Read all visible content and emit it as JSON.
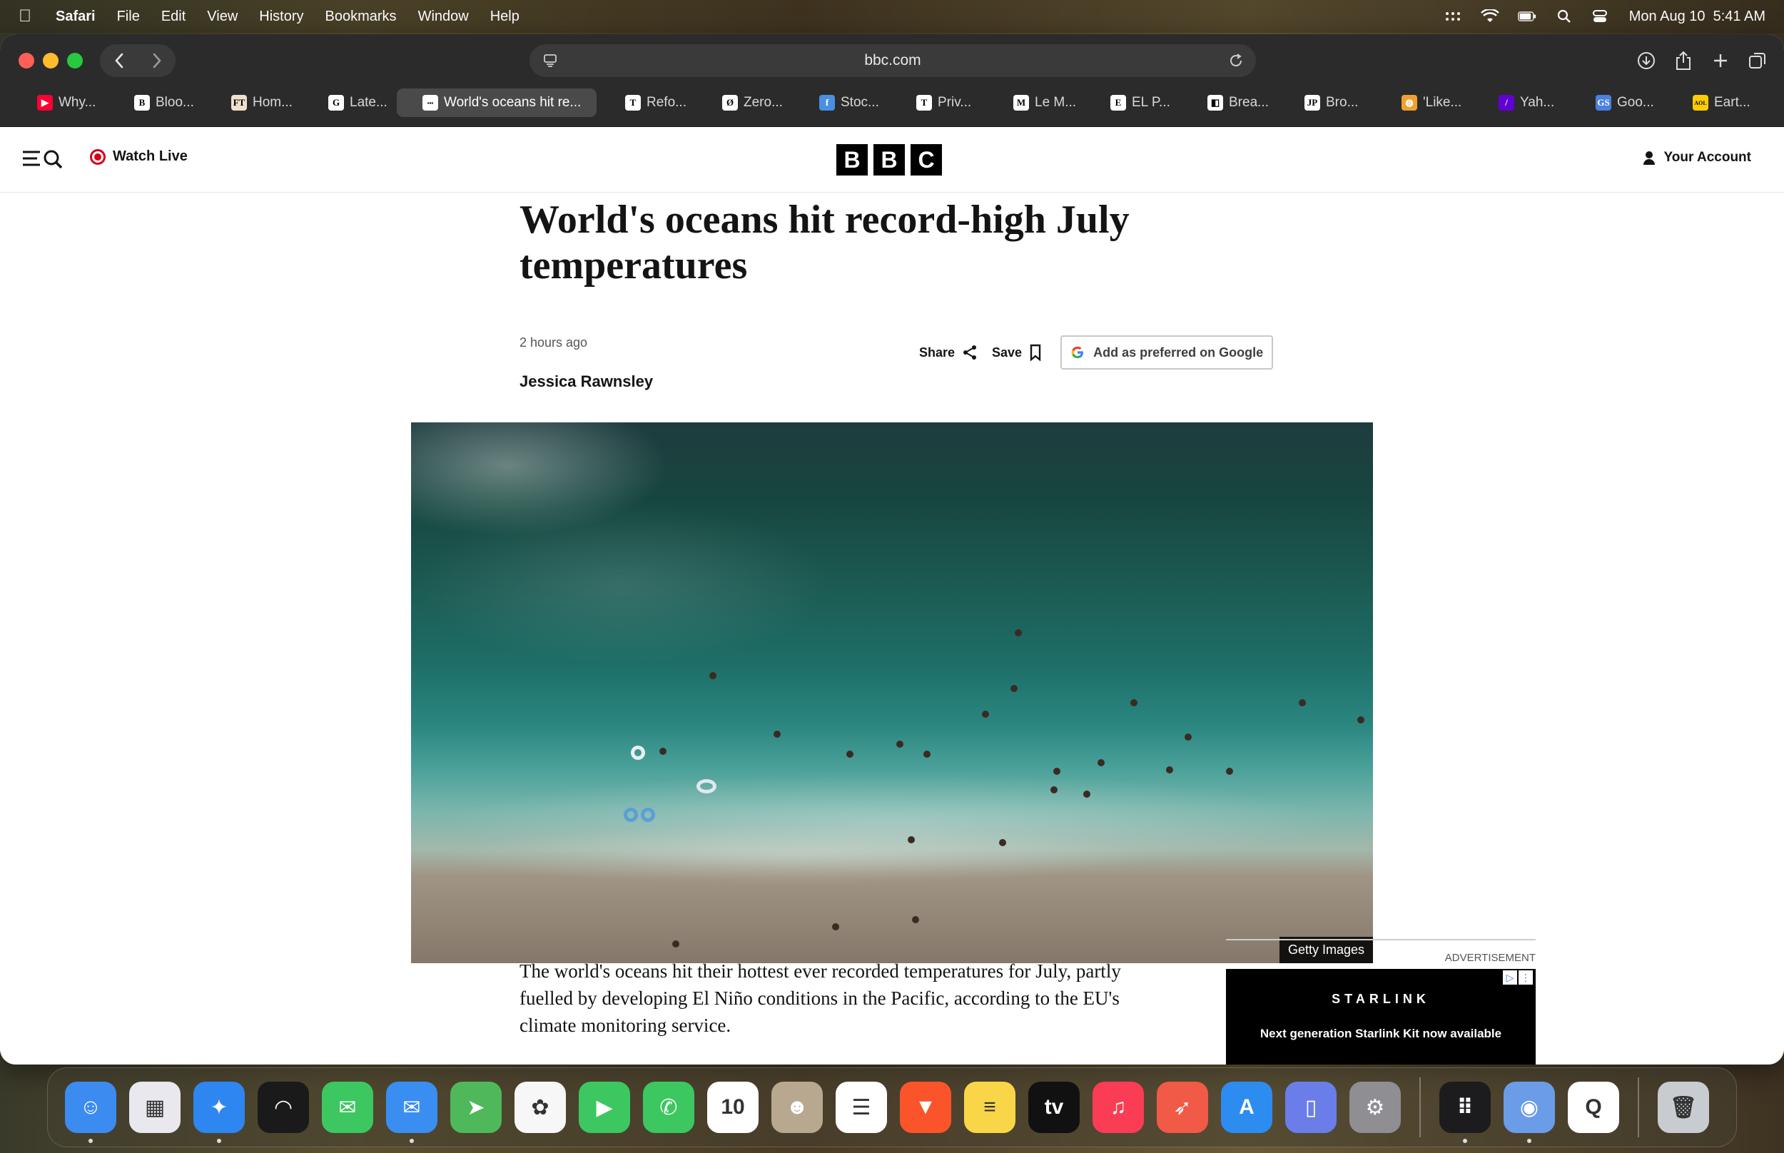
{
  "menubar": {
    "app_name": "Safari",
    "items": [
      "File",
      "Edit",
      "View",
      "History",
      "Bookmarks",
      "Window",
      "Help"
    ],
    "clock": "Mon Aug 10  5:41 AM"
  },
  "browser": {
    "url": "bbc.com",
    "tabs": [
      {
        "label": "Why...",
        "favicon": "youtube-icon",
        "color": "#ff0033",
        "glyph": "▶"
      },
      {
        "label": "Bloo...",
        "favicon": "bloomberg-icon",
        "color": "#ffffff",
        "glyph": "B"
      },
      {
        "label": "Hom...",
        "favicon": "ft-icon",
        "color": "#f2dfce",
        "glyph": "FT"
      },
      {
        "label": "Late...",
        "favicon": "guardian-icon",
        "color": "#ffffff",
        "glyph": "G"
      },
      {
        "label": "World's oceans hit re...",
        "favicon": "bbc-icon",
        "color": "#ffffff",
        "glyph": "▪▪▪",
        "active": true
      },
      {
        "label": "Refo...",
        "favicon": "telegraph-icon",
        "color": "#ffffff",
        "glyph": "T"
      },
      {
        "label": "Zero...",
        "favicon": "zerohedge-icon",
        "color": "#ffffff",
        "glyph": "Ø"
      },
      {
        "label": "Stoc...",
        "favicon": "stock-icon",
        "color": "#4a90e2",
        "glyph": "f"
      },
      {
        "label": "Priv...",
        "favicon": "nyt-icon",
        "color": "#ffffff",
        "glyph": "T"
      },
      {
        "label": "Le M...",
        "favicon": "lemonde-icon",
        "color": "#ffffff",
        "glyph": "M"
      },
      {
        "label": "EL P...",
        "favicon": "elpais-icon",
        "color": "#ffffff",
        "glyph": "E"
      },
      {
        "label": "Brea...",
        "favicon": "breaking-icon",
        "color": "#ffffff",
        "glyph": "◧"
      },
      {
        "label": "Bro...",
        "favicon": "jp-icon",
        "color": "#ffffff",
        "glyph": "JP"
      },
      {
        "label": "'Like...",
        "favicon": "like-icon",
        "color": "#f0a030",
        "glyph": "◍"
      },
      {
        "label": "Yah...",
        "favicon": "yahoo-icon",
        "color": "#6001d2",
        "glyph": "/"
      },
      {
        "label": "Goo...",
        "favicon": "google-sheets-icon",
        "color": "#4a80e0",
        "glyph": "GS"
      },
      {
        "label": "Eart...",
        "favicon": "aol-icon",
        "color": "#ffcc00",
        "glyph": "AOL"
      }
    ]
  },
  "bbc": {
    "watch_live": "Watch Live",
    "logo_letters": [
      "B",
      "B",
      "C"
    ],
    "account": "Your Account"
  },
  "article": {
    "headline": "World's oceans hit record-high July temperatures",
    "timestamp": "2 hours ago",
    "author": "Jessica Rawnsley",
    "share_label": "Share",
    "save_label": "Save",
    "google_pref_label": "Add as preferred on Google",
    "image_credit": "Getty Images",
    "paragraphs": [
      "The world's oceans hit their hottest ever recorded temperatures for July, partly fuelled by developing El Niño conditions in the Pacific, according to the EU's climate monitoring service."
    ]
  },
  "ad": {
    "label": "ADVERTISEMENT",
    "brand": "STARLINK",
    "copy": "Next generation Starlink Kit now available"
  },
  "dock": {
    "items": [
      {
        "name": "finder-icon",
        "color": "#3b8bf0",
        "glyph": "☺",
        "running": true
      },
      {
        "name": "launchpad-icon",
        "color": "#e8e8ee",
        "glyph": "▦",
        "running": false
      },
      {
        "name": "safari-icon",
        "color": "#2e86f0",
        "glyph": "✦",
        "running": true
      },
      {
        "name": "podcasts-wave-icon",
        "color": "#1a1a1a",
        "glyph": "◠",
        "running": false
      },
      {
        "name": "messages-icon",
        "color": "#3cc760",
        "glyph": "✉",
        "running": false
      },
      {
        "name": "mail-icon",
        "color": "#3a8ef2",
        "glyph": "✉",
        "running": true
      },
      {
        "name": "maps-icon",
        "color": "#4fb85a",
        "glyph": "➤",
        "running": false
      },
      {
        "name": "photos-icon",
        "color": "#f7f7f7",
        "glyph": "✿",
        "running": false
      },
      {
        "name": "facetime-icon",
        "color": "#3cc760",
        "glyph": "▶",
        "running": false
      },
      {
        "name": "phone-icon",
        "color": "#3cc760",
        "glyph": "✆",
        "running": false
      },
      {
        "name": "calendar-icon",
        "color": "#ffffff",
        "glyph": "10",
        "running": false
      },
      {
        "name": "contacts-icon",
        "color": "#b8a890",
        "glyph": "☻",
        "running": false
      },
      {
        "name": "reminders-icon",
        "color": "#ffffff",
        "glyph": "☰",
        "running": false
      },
      {
        "name": "brave-icon",
        "color": "#fb542b",
        "glyph": "▼",
        "running": false
      },
      {
        "name": "notes-icon",
        "color": "#f9d648",
        "glyph": "≡",
        "running": false
      },
      {
        "name": "apple-tv-icon",
        "color": "#111111",
        "glyph": "tv",
        "running": false
      },
      {
        "name": "music-icon",
        "color": "#fa3c55",
        "glyph": "♫",
        "running": false
      },
      {
        "name": "rocket-icon",
        "color": "#f05a46",
        "glyph": "➶",
        "running": false
      },
      {
        "name": "app-store-icon",
        "color": "#2d8cf0",
        "glyph": "A",
        "running": false
      },
      {
        "name": "simulator-icon",
        "color": "#6b7de8",
        "glyph": "▯",
        "running": false
      },
      {
        "name": "system-settings-icon",
        "color": "#8e8e93",
        "glyph": "⚙",
        "running": false
      },
      {
        "name": "separator",
        "color": "",
        "glyph": "",
        "running": false
      },
      {
        "name": "apps-grid-icon",
        "color": "#1c1c1e",
        "glyph": "⠿",
        "running": true
      },
      {
        "name": "disk-utility-icon",
        "color": "#6a9ce8",
        "glyph": "◉",
        "running": true
      },
      {
        "name": "quicktime-icon",
        "color": "#ffffff",
        "glyph": "Q",
        "running": false
      },
      {
        "name": "separator",
        "color": "",
        "glyph": "",
        "running": false
      },
      {
        "name": "trash-icon",
        "color": "#c8ccd0",
        "glyph": "🗑",
        "running": false
      }
    ]
  }
}
